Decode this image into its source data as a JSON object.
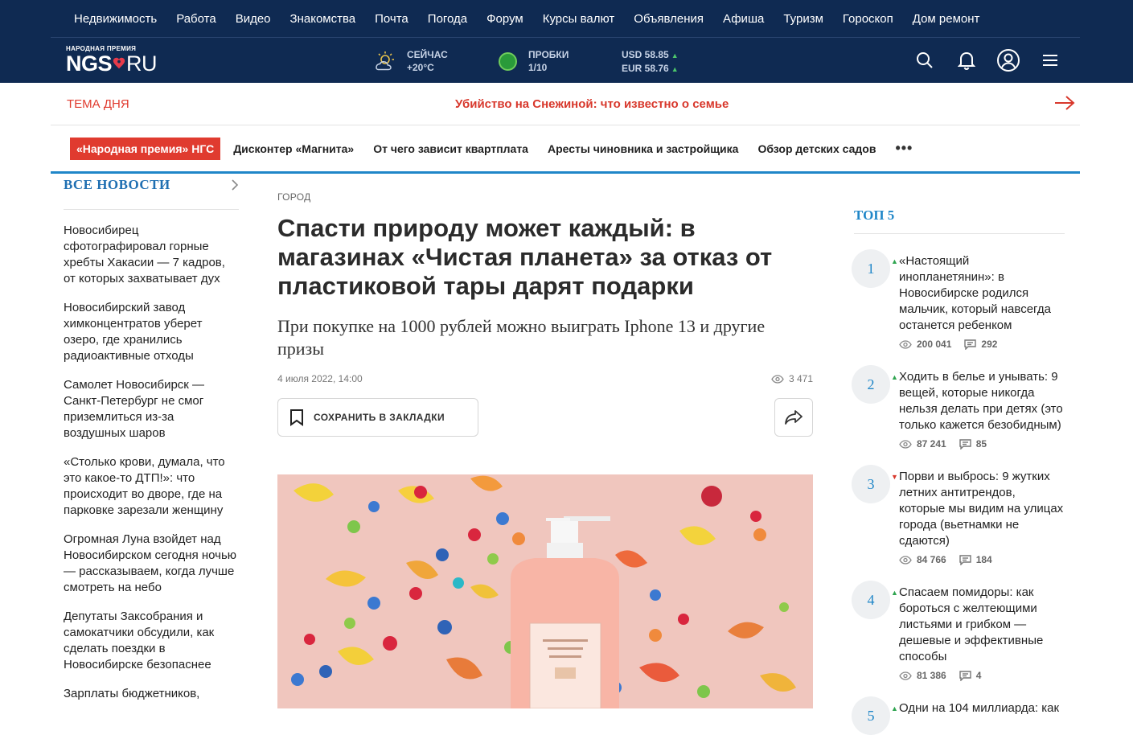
{
  "nav": {
    "items": [
      "Недвижимость",
      "Работа",
      "Видео",
      "Знакомства",
      "Почта",
      "Погода",
      "Форум",
      "Курсы валют",
      "Объявления",
      "Афиша",
      "Туризм",
      "Гороскоп",
      "Дом ремонт"
    ]
  },
  "logo": {
    "subtitle": "НАРОДНАЯ ПРЕМИЯ",
    "brand": "NGS",
    "domain": "RU"
  },
  "weather": {
    "label": "СЕЙЧАС",
    "temp": "+20°C",
    "icon": "partly-sunny-icon"
  },
  "traffic": {
    "label": "ПРОБКИ",
    "level": "1/10"
  },
  "currency": {
    "usd": "USD 58.85",
    "eur": "EUR 58.76",
    "trend": "▲"
  },
  "topic": {
    "label": "ТЕМА ДНЯ",
    "title": "Убийство на Снежиной: что известно о семье"
  },
  "tags": {
    "badge": "«Народная премия» НГС",
    "items": [
      "Дисконтер «Магнита»",
      "От чего зависит квартплата",
      "Аресты чиновника и застройщика",
      "Обзор детских садов"
    ],
    "more": "•••"
  },
  "left": {
    "title": "ВСЕ НОВОСТИ",
    "news": [
      "Новосибирец сфотографировал горные хребты Хакасии — 7 кадров, от которых захватывает дух",
      "Новосибирский завод химконцентратов уберет озеро, где хранились радиоактивные отходы",
      "Самолет Новосибирск — Санкт-Петербург не смог приземлиться из-за воздушных шаров",
      "«Столько крови, думала, что это какое-то ДТП!»: что происходит во дворе, где на парковке зарезали женщину",
      "Огромная Луна взойдет над Новосибирском сегодня ночью — рассказываем, когда лучше смотреть на небо",
      "Депутаты Заксобрания и самокатчики обсудили, как сделать поездки в Новосибирске безопаснее",
      "Зарплаты бюджетников,"
    ]
  },
  "article": {
    "rubric": "ГОРОД",
    "headline": "Спасти природу может каждый: в магазинах «Чистая планета» за отказ от пластиковой тары дарят подарки",
    "subhead": "При покупке на 1000 рублей можно выиграть Iphone 13 и другие призы",
    "date": "4 июля 2022, 14:00",
    "views": "3 471",
    "save_label": "СОХРАНИТЬ В ЗАКЛАДКИ"
  },
  "top5": {
    "title": "ТОП 5",
    "items": [
      {
        "num": "1",
        "trend": "up",
        "title": "«Настоящий инопланетянин»: в Новосибирске родился мальчик, который навсегда останется ребенком",
        "views": "200 041",
        "comments": "292"
      },
      {
        "num": "2",
        "trend": "up",
        "title": "Ходить в белье и унывать: 9 вещей, которые никогда нельзя делать при детях (это только кажется безобидным)",
        "views": "87 241",
        "comments": "85"
      },
      {
        "num": "3",
        "trend": "down",
        "title": "Порви и выбрось: 9 жутких летних антитрендов, которые мы видим на улицах города (вьетнамки не сдаются)",
        "views": "84 766",
        "comments": "184"
      },
      {
        "num": "4",
        "trend": "up",
        "title": "Спасаем помидоры: как бороться с желтеющими листьями и грибком — дешевые и эффективные способы",
        "views": "81 386",
        "comments": "4"
      },
      {
        "num": "5",
        "trend": "up",
        "title": "Одни на 104 миллиарда: как",
        "views": "",
        "comments": ""
      }
    ]
  },
  "colors": {
    "header_bg": "#0f2a52",
    "accent_red": "#e03b2f",
    "accent_blue": "#1f86c8"
  }
}
